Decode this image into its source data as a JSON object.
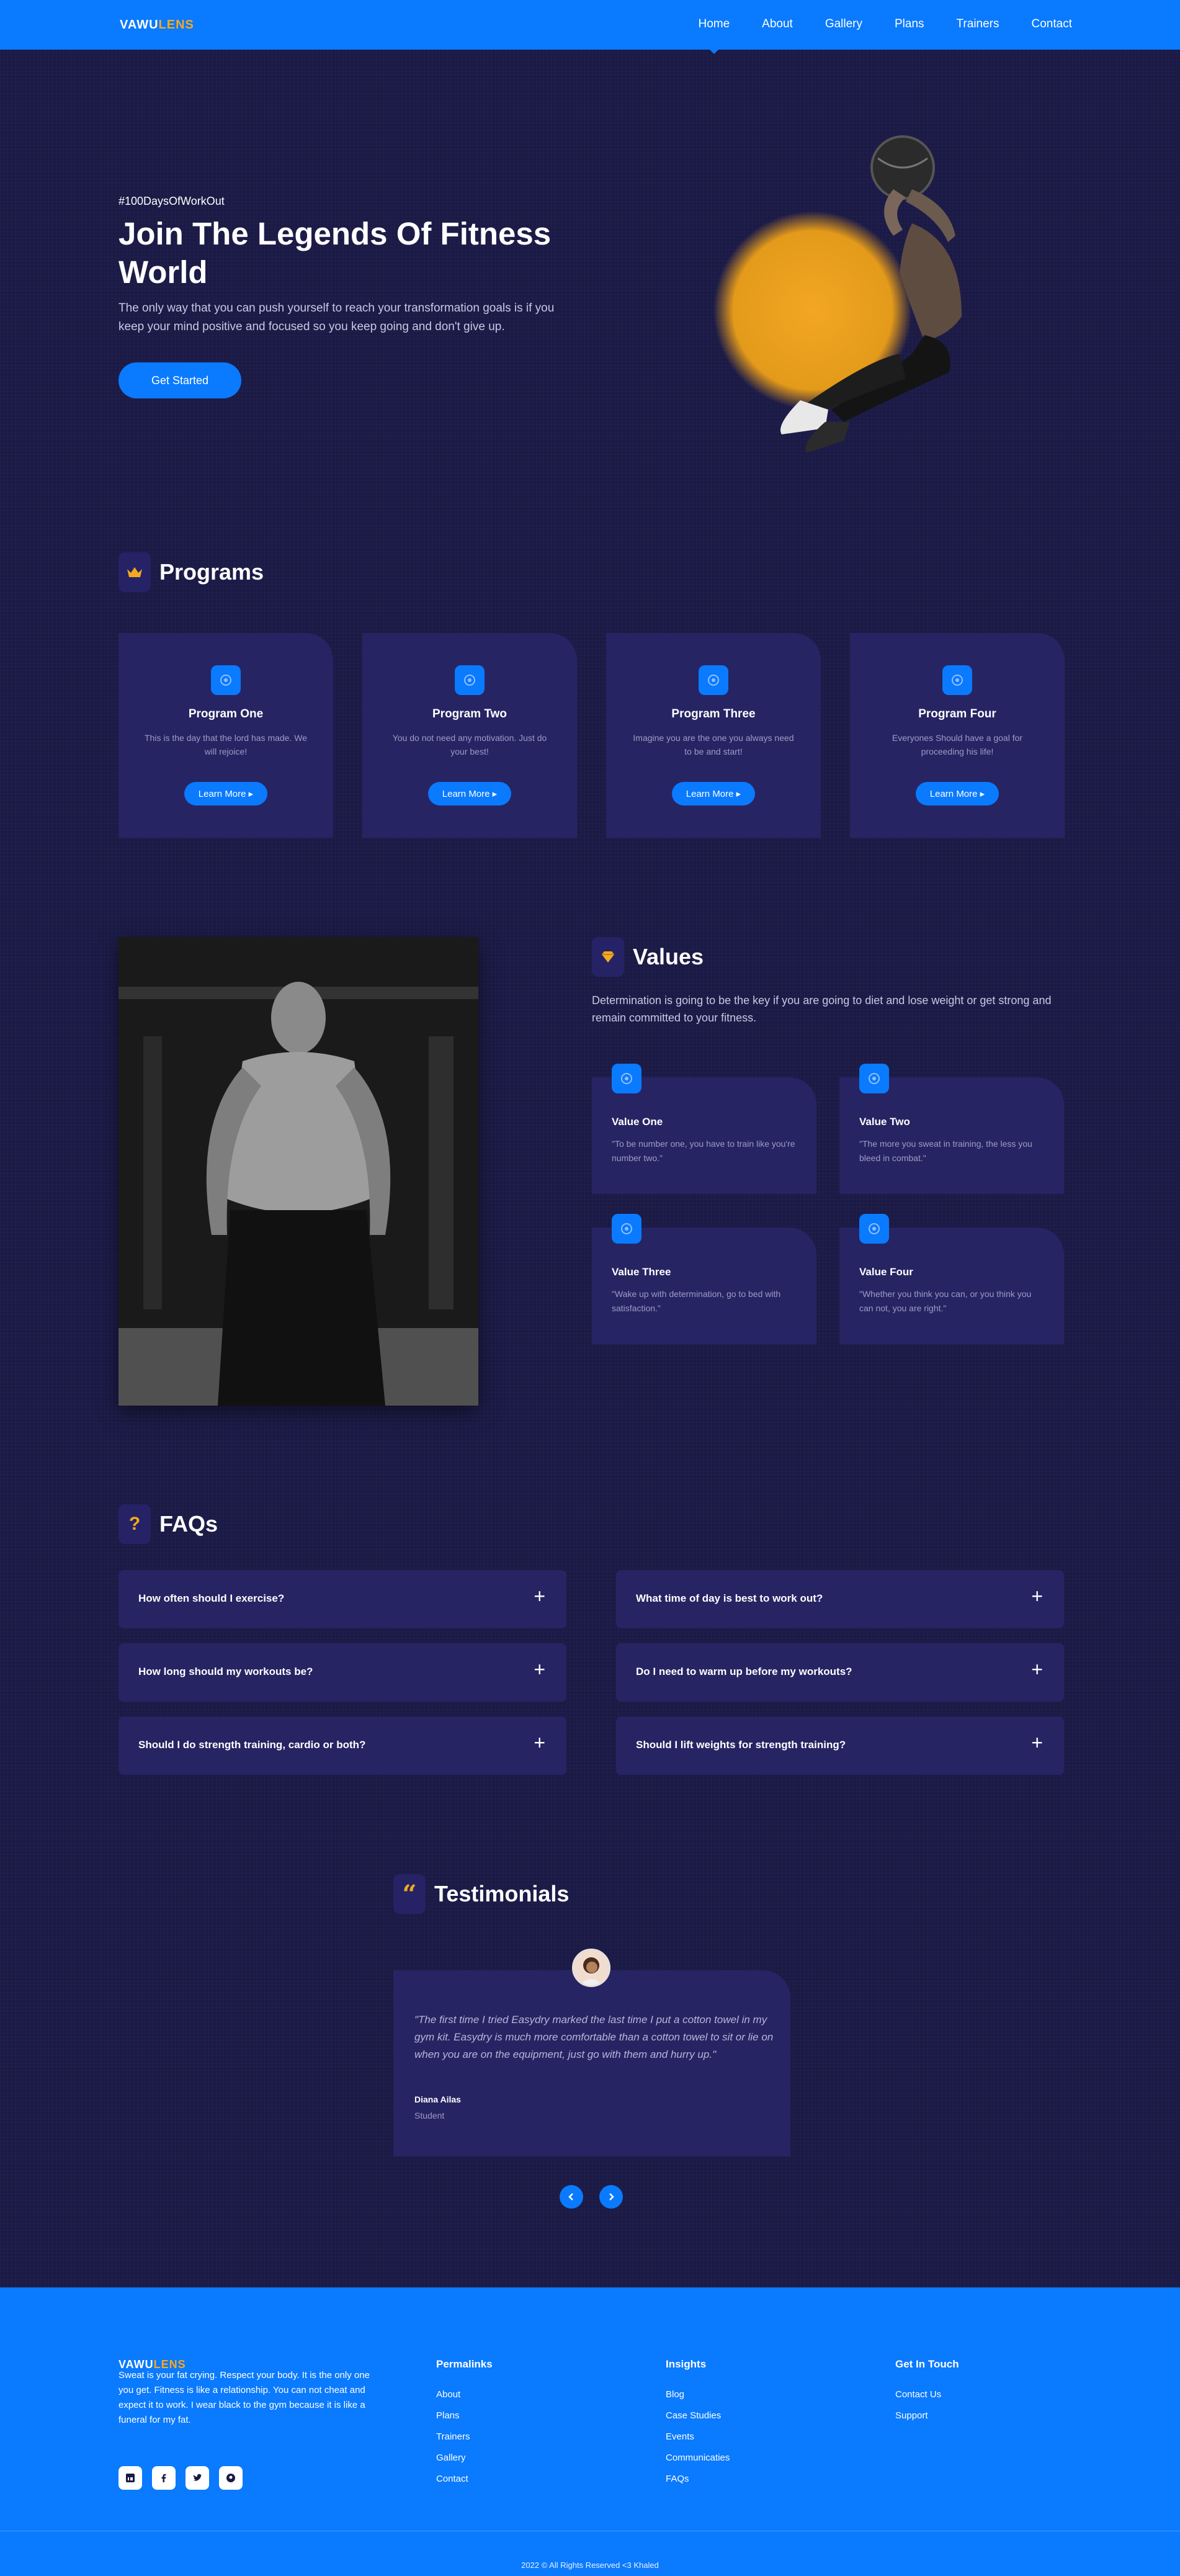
{
  "brand": {
    "name_main": "VAWU",
    "name_accent": "LENS",
    "accent_color": "#f5a91f",
    "primary_color": "#0a7aff"
  },
  "nav": {
    "items": [
      "Home",
      "About",
      "Gallery",
      "Plans",
      "Trainers",
      "Contact"
    ],
    "active": "Home"
  },
  "hero": {
    "tag": "#100DaysOfWorkOut",
    "title": "Join The Legends Of Fitness World",
    "text": "The only way that you can push yourself to reach your transformation goals is if you keep your mind positive and focused so you keep going and don't give up.",
    "cta": "Get Started"
  },
  "programs": {
    "title": "Programs",
    "icon": "crown-icon",
    "items": [
      {
        "title": "Program One",
        "text": "This is the day that the lord has made. We will rejoice!",
        "button": "Learn More"
      },
      {
        "title": "Program Two",
        "text": "You do not need any motivation. Just do your best!",
        "button": "Learn More"
      },
      {
        "title": "Program Three",
        "text": "Imagine you are the one you always need to be and start!",
        "button": "Learn More"
      },
      {
        "title": "Program Four",
        "text": "Everyones Should have a goal for proceeding his life!",
        "button": "Learn More"
      }
    ]
  },
  "values": {
    "title": "Values",
    "icon": "diamond-icon",
    "text": "Determination is going to be the key if you are going to diet and lose weight or get strong and remain committed to your fitness.",
    "items": [
      {
        "title": "Value One",
        "text": "\"To be number one, you have to train like you're number two.\""
      },
      {
        "title": "Value Two",
        "text": "\"The more you sweat in training, the less you bleed in combat.\""
      },
      {
        "title": "Value Three",
        "text": "\"Wake up with determination, go to bed with satisfaction.\""
      },
      {
        "title": "Value Four",
        "text": "\"Whether you think you can, or you think you can not, you are right.\""
      }
    ]
  },
  "faqs": {
    "title": "FAQs",
    "icon": "question-icon",
    "items": [
      "How often should I exercise?",
      "What time of day is best to work out?",
      "How long should my workouts be?",
      "Do I need to warm up before my workouts?",
      "Should I do strength training, cardio or both?",
      "Should I lift weights for strength training?"
    ]
  },
  "testimonials": {
    "title": "Testimonials",
    "icon": "quote-icon",
    "quote": "\"The first time I tried Easydry marked the last time I put a cotton towel in my gym kit. Easydry is much more comfortable than a cotton towel to sit or lie on when you are on the equipment, just go with them and hurry up.\"",
    "name": "Diana Ailas",
    "role": "Student"
  },
  "footer": {
    "about": "Sweat is your fat crying. Respect your body. It is the only one you get. Fitness is like a relationship. You can not cheat and expect it to work. I wear black to the gym because it is like a funeral for my fat.",
    "columns": [
      {
        "title": "Permalinks",
        "links": [
          "About",
          "Plans",
          "Trainers",
          "Gallery",
          "Contact"
        ]
      },
      {
        "title": "Insights",
        "links": [
          "Blog",
          "Case Studies",
          "Events",
          "Communicaties",
          "FAQs"
        ]
      },
      {
        "title": "Get In Touch",
        "links": [
          "Contact Us",
          "Support"
        ]
      }
    ],
    "social": [
      "linkedin-icon",
      "facebook-icon",
      "twitter-icon",
      "pinterest-icon"
    ],
    "copyright": "2022 © All Rights Reserved <3 Khaled"
  }
}
